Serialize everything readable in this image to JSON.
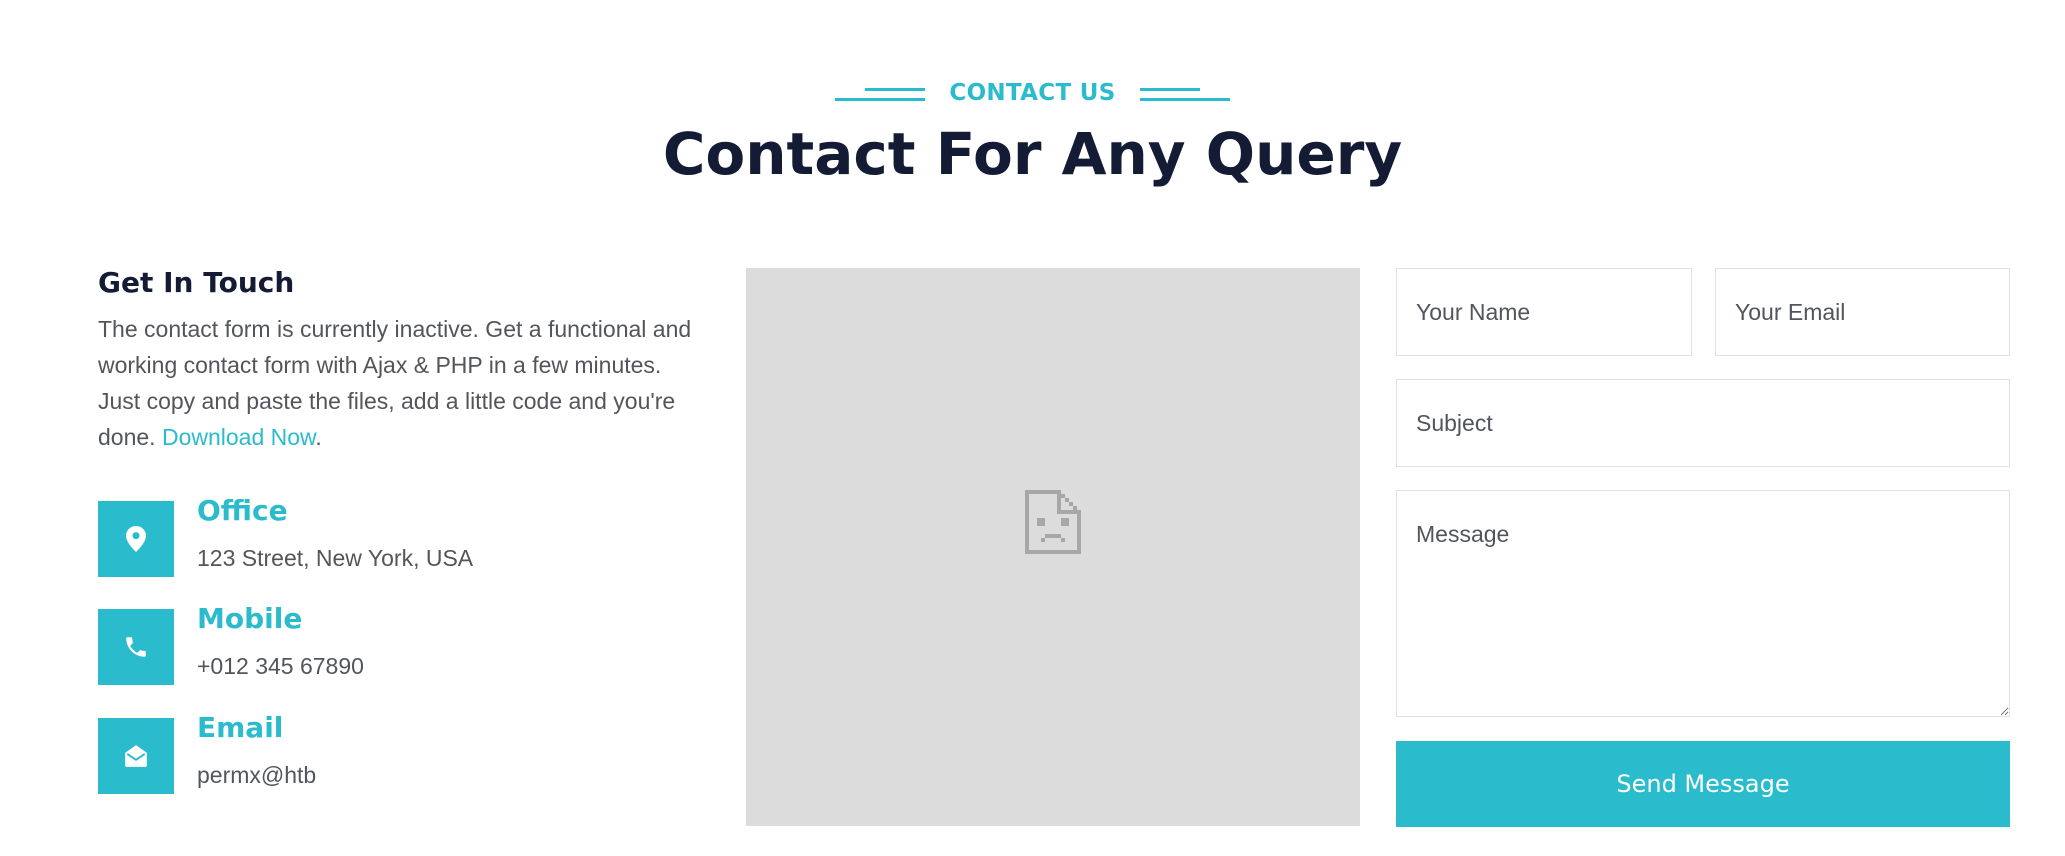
{
  "header": {
    "eyebrow": "CONTACT US",
    "title": "Contact For Any Query"
  },
  "touch": {
    "title": "Get In Touch",
    "description": "The contact form is currently inactive. Get a functional and working contact form with Ajax & PHP in a few minutes. Just copy and paste the files, add a little code and you're done.",
    "link_label": "Download Now",
    "suffix": "."
  },
  "info": [
    {
      "icon": "map-marker-icon",
      "title": "Office",
      "text": "123 Street, New York, USA"
    },
    {
      "icon": "phone-icon",
      "title": "Mobile",
      "text": "+012 345 67890"
    },
    {
      "icon": "envelope-open-icon",
      "title": "Email",
      "text": "permx@htb"
    }
  ],
  "map": {
    "icon": "broken-page-icon"
  },
  "form": {
    "name_placeholder": "Your Name",
    "email_placeholder": "Your Email",
    "subject_placeholder": "Subject",
    "message_placeholder": "Message",
    "submit_label": "Send Message"
  },
  "colors": {
    "accent": "#2abbcc",
    "heading": "#141b34",
    "body_text": "#52565b",
    "map_background": "#dcdcdc"
  }
}
